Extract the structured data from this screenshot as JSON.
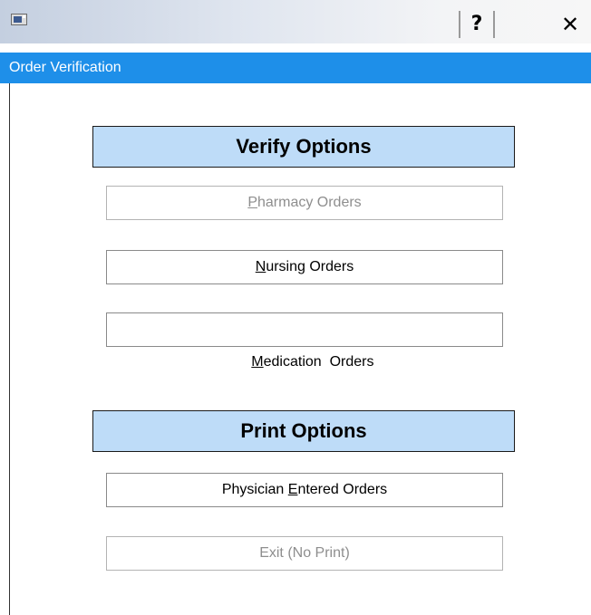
{
  "titlebar": {
    "icon": "window-app-icon",
    "help_label": "?",
    "close_label": "✕"
  },
  "caption": {
    "title": "Order Verification"
  },
  "verify_options": {
    "header": "Verify Options",
    "buttons": [
      {
        "prefix": "",
        "accel": "P",
        "suffix": "harmacy Orders",
        "enabled": false
      },
      {
        "prefix": "",
        "accel": "N",
        "suffix": "ursing Orders",
        "enabled": true
      },
      {
        "prefix": "",
        "accel": "M",
        "suffix": "edication  Orders",
        "enabled": true
      }
    ]
  },
  "print_options": {
    "header": "Print Options",
    "buttons": [
      {
        "prefix": "Physician ",
        "accel": "E",
        "suffix": "ntered Orders",
        "enabled": true
      },
      {
        "prefix": "Exit (No Print)",
        "accel": "",
        "suffix": "",
        "enabled": false
      }
    ]
  },
  "colors": {
    "caption_bg": "#1e8fe9",
    "header_bg": "#bedcf8",
    "disabled_text": "#8e8e8e"
  }
}
